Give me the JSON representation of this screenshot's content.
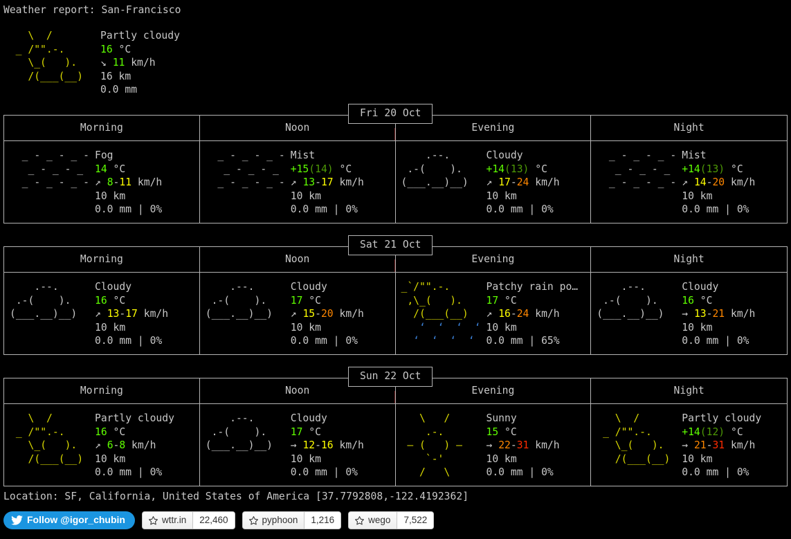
{
  "header": {
    "report_title": "Weather report: San-Francisco"
  },
  "current": {
    "art": "    \\  /\n  _ /\"\".-.\n    \\_(   ).\n    /(___(__)",
    "condition": "Partly cloudy",
    "temperature": "16",
    "temperature_unit": " °C",
    "wind_arrow": "↘",
    "wind_value": "11",
    "wind_unit": " km/h",
    "visibility": "16 km",
    "precipitation": "0.0 mm"
  },
  "columns": [
    "Morning",
    "Noon",
    "Evening",
    "Night"
  ],
  "days": [
    {
      "date": "Fri 20 Oct",
      "cells": [
        {
          "art": "  _ - _ - _ -\n   _ - _ - _\n  _ - _ - _ -",
          "art_color": "art-w",
          "condition": "Fog",
          "temp_main": "14",
          "temp_paren": "",
          "temp_unit": " °C",
          "wind_arrow": "↗",
          "wind_low": "8",
          "wind_low_color": "g",
          "wind_high": "11",
          "wind_high_color": "y",
          "wind_unit": " km/h",
          "visibility": "10 km",
          "precip": "0.0 mm | 0%"
        },
        {
          "art": "  _ - _ - _ -\n   _ - _ - _\n  _ - _ - _ -",
          "art_color": "art-w",
          "condition": "Mist",
          "temp_main": "+15",
          "temp_paren": "(14)",
          "temp_unit": " °C",
          "wind_arrow": "↗",
          "wind_low": "13",
          "wind_low_color": "g",
          "wind_high": "17",
          "wind_high_color": "y",
          "wind_unit": " km/h",
          "visibility": "10 km",
          "precip": "0.0 mm | 0%"
        },
        {
          "art": "    .--.\n .-(    ).\n(___.__)__)",
          "art_color": "art-w",
          "condition": "Cloudy",
          "temp_main": "+14",
          "temp_paren": "(13)",
          "temp_unit": " °C",
          "wind_arrow": "↗",
          "wind_low": "17",
          "wind_low_color": "y",
          "wind_high": "24",
          "wind_high_color": "o",
          "wind_unit": " km/h",
          "visibility": "10 km",
          "precip": "0.0 mm | 0%"
        },
        {
          "art": "  _ - _ - _ -\n   _ - _ - _\n  _ - _ - _ -",
          "art_color": "art-w",
          "condition": "Mist",
          "temp_main": "+14",
          "temp_paren": "(13)",
          "temp_unit": " °C",
          "wind_arrow": "↗",
          "wind_low": "14",
          "wind_low_color": "y",
          "wind_high": "20",
          "wind_high_color": "o",
          "wind_unit": " km/h",
          "visibility": "10 km",
          "precip": "0.0 mm | 0%"
        }
      ]
    },
    {
      "date": "Sat 21 Oct",
      "cells": [
        {
          "art": "    .--.\n .-(    ).\n(___.__)__)",
          "art_color": "art-w",
          "condition": "Cloudy",
          "temp_main": "16",
          "temp_paren": "",
          "temp_unit": " °C",
          "wind_arrow": "↗",
          "wind_low": "13",
          "wind_low_color": "y",
          "wind_high": "17",
          "wind_high_color": "y",
          "wind_unit": " km/h",
          "visibility": "10 km",
          "precip": "0.0 mm | 0%"
        },
        {
          "art": "    .--.\n .-(    ).\n(___.__)__)",
          "art_color": "art-w",
          "condition": "Cloudy",
          "temp_main": "17",
          "temp_paren": "",
          "temp_unit": " °C",
          "wind_arrow": "↗",
          "wind_low": "15",
          "wind_low_color": "y",
          "wind_high": "20",
          "wind_high_color": "o",
          "wind_unit": " km/h",
          "visibility": "10 km",
          "precip": "0.0 mm | 0%"
        },
        {
          "art": "_`/\"\".-.\n ,\\_(   ).\n  /(___(__)",
          "art_color": "art-y",
          "art_rain_1": "   ‘  ‘  ‘  ‘",
          "art_rain_2": "  ‘  ‘  ‘  ‘",
          "condition": "Patchy rain po…",
          "temp_main": "17",
          "temp_paren": "",
          "temp_unit": " °C",
          "wind_arrow": "↗",
          "wind_low": "16",
          "wind_low_color": "y",
          "wind_high": "24",
          "wind_high_color": "o",
          "wind_unit": " km/h",
          "visibility": "10 km",
          "precip": "0.0 mm | 65%"
        },
        {
          "art": "    .--.\n .-(    ).\n(___.__)__)",
          "art_color": "art-w",
          "condition": "Cloudy",
          "temp_main": "16",
          "temp_paren": "",
          "temp_unit": " °C",
          "wind_arrow": "→",
          "wind_low": "13",
          "wind_low_color": "y",
          "wind_high": "21",
          "wind_high_color": "o",
          "wind_unit": " km/h",
          "visibility": "10 km",
          "precip": "0.0 mm | 0%"
        }
      ]
    },
    {
      "date": "Sun 22 Oct",
      "cells": [
        {
          "art": "   \\  /\n _ /\"\".-.\n   \\_(   ).\n   /(___(__)",
          "art_color": "art-y",
          "condition": "Partly cloudy",
          "temp_main": "16",
          "temp_paren": "",
          "temp_unit": " °C",
          "wind_arrow": "↗",
          "wind_low": "6",
          "wind_low_color": "g",
          "wind_high": "8",
          "wind_high_color": "g",
          "wind_unit": " km/h",
          "visibility": "10 km",
          "precip": "0.0 mm | 0%"
        },
        {
          "art": "    .--.\n .-(    ).\n(___.__)__)",
          "art_color": "art-w",
          "condition": "Cloudy",
          "temp_main": "17",
          "temp_paren": "",
          "temp_unit": " °C",
          "wind_arrow": "→",
          "wind_low": "12",
          "wind_low_color": "y",
          "wind_high": "16",
          "wind_high_color": "y",
          "wind_unit": " km/h",
          "visibility": "10 km",
          "precip": "0.0 mm | 0%"
        },
        {
          "art": "   \\   /\n    .-.\n – (   ) –\n    `-'\n   /   \\",
          "art_color": "art-y",
          "condition": "Sunny",
          "temp_main": "15",
          "temp_paren": "",
          "temp_unit": " °C",
          "wind_arrow": "→",
          "wind_low": "22",
          "wind_low_color": "o",
          "wind_high": "31",
          "wind_high_color": "r",
          "wind_unit": " km/h",
          "visibility": "10 km",
          "precip": "0.0 mm | 0%"
        },
        {
          "art": "   \\  /\n _ /\"\".-.\n   \\_(   ).\n   /(___(__)",
          "art_color": "art-y",
          "condition": "Partly cloudy",
          "temp_main": "+14",
          "temp_paren": "(12)",
          "temp_unit": " °C",
          "wind_arrow": "→",
          "wind_low": "21",
          "wind_low_color": "o",
          "wind_high": "31",
          "wind_high_color": "r",
          "wind_unit": " km/h",
          "visibility": "10 km",
          "precip": "0.0 mm | 0%"
        }
      ]
    }
  ],
  "footer": {
    "location": "Location: SF, California, United States of America [37.7792808,-122.4192362]",
    "twitter_label": "Follow @igor_chubin",
    "github_buttons": [
      {
        "label": "wttr.in",
        "count": "22,460"
      },
      {
        "label": "pyphoon",
        "count": "1,216"
      },
      {
        "label": "wego",
        "count": "7,522"
      }
    ]
  },
  "colors": {
    "background": "#000000",
    "foreground": "#c8c8c8",
    "green": "#5fff00",
    "yellow": "#ffff00",
    "orange": "#ff8700",
    "red": "#ff2b00",
    "art_yellow": "#d7d700",
    "rain_blue": "#3a7fd5",
    "border": "#b4b4b4",
    "twitter_blue": "#1b95e0"
  }
}
